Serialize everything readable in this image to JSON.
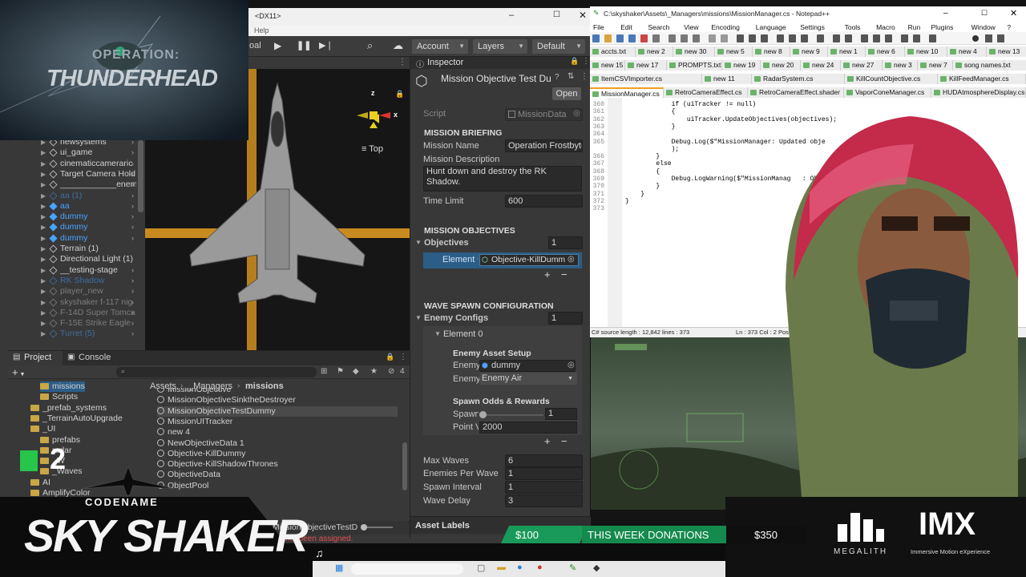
{
  "stream": {
    "logo_top_line": "OPERATION:",
    "logo_bottom_line": "THUNDERHEAD",
    "codename_label": "CODENAME",
    "game_title": "SKY SHAKER",
    "badge_count": "2",
    "donation_left": "$100",
    "donation_title": "THIS WEEK DONATIONS",
    "donation_right": "$350",
    "sponsor_name": "MEGALITH",
    "partner_name": "IMX",
    "partner_tagline": "Immersive Motion eXperience"
  },
  "unity": {
    "title_suffix": "<DX11>",
    "menu_help": "Help",
    "toolbar": {
      "account_label": "Account",
      "layers_label": "Layers",
      "layout_label": "Default",
      "left_tab_fragment": "oal"
    },
    "scene": {
      "gizmo_count": "0",
      "orientation_label": "Top",
      "axis_x": "x",
      "axis_z": "z"
    },
    "hierarchy": [
      {
        "label": "newsystems",
        "style": "normal",
        "arrow": true
      },
      {
        "label": "ui_game",
        "style": "normal",
        "arrow": true
      },
      {
        "label": "cinematiccameraric",
        "style": "normal",
        "arrow": true
      },
      {
        "label": "Target Camera Hold",
        "style": "normal",
        "arrow": true
      },
      {
        "label": "____________enem",
        "style": "normal",
        "arrow": true
      },
      {
        "label": "aa (1)",
        "style": "dimblue",
        "arrow": true
      },
      {
        "label": "aa",
        "style": "blue",
        "arrow": true
      },
      {
        "label": "dummy",
        "style": "blue",
        "arrow": true
      },
      {
        "label": "dummy",
        "style": "blue",
        "arrow": true
      },
      {
        "label": "dummy",
        "style": "blue",
        "arrow": true
      },
      {
        "label": "Terrain (1)",
        "style": "normal",
        "arrow": false
      },
      {
        "label": "Directional Light (1)",
        "style": "normal",
        "arrow": false
      },
      {
        "label": "__testing-stage",
        "style": "normal",
        "arrow": true
      },
      {
        "label": "RK Shadow",
        "style": "dimblue",
        "arrow": true
      },
      {
        "label": "player_new",
        "style": "dim",
        "arrow": true
      },
      {
        "label": "skyshaker f-117 nig",
        "style": "dim",
        "arrow": true
      },
      {
        "label": "F-14D Super Tomca",
        "style": "dim",
        "arrow": true
      },
      {
        "label": "F-15E Strike Eagle",
        "style": "dim",
        "arrow": true
      },
      {
        "label": "Turret (5)",
        "style": "dimblue",
        "arrow": true
      }
    ],
    "inspector": {
      "tab_label": "Inspector",
      "component_title": "Mission Objective Test Du",
      "open_button": "Open",
      "script_label": "Script",
      "script_value": "MissionData",
      "briefing_header": "MISSION BRIEFING",
      "mission_name_label": "Mission Name",
      "mission_name_value": "Operation Frostbyte",
      "mission_description_label": "Mission Description",
      "mission_description_value": "Hunt down and destroy the RK Shadow.",
      "time_limit_label": "Time Limit",
      "time_limit_value": "600",
      "objectives_header": "MISSION OBJECTIVES",
      "objectives_label": "Objectives",
      "objectives_count": "1",
      "element_label": "Element 0",
      "element_value": "Objective-KillDumm",
      "wave_header": "WAVE SPAWN CONFIGURATION",
      "enemy_configs_label": "Enemy Configs",
      "enemy_configs_count": "1",
      "config_element_label": "Element 0",
      "asset_setup_header": "Enemy Asset Setup",
      "enemy_prefab_label": "Enemy",
      "enemy_prefab_value": "dummy",
      "enemy_type_label": "Enemy",
      "enemy_type_value": "Enemy Air",
      "odds_header": "Spawn Odds & Rewards",
      "spawn_label": "Spawn",
      "spawn_value": "1",
      "points_label": "Point V",
      "points_value": "2000",
      "max_waves_label": "Max Waves",
      "max_waves_value": "6",
      "enemies_per_wave_label": "Enemies Per Wave",
      "enemies_per_wave_value": "1",
      "spawn_interval_label": "Spawn Interval",
      "spawn_interval_value": "1",
      "wave_delay_label": "Wave Delay",
      "wave_delay_value": "3",
      "asset_labels_label": "Asset Labels",
      "plus": "+",
      "minus": "−"
    },
    "project": {
      "tab_project": "Project",
      "tab_console": "Console",
      "add_label": "+",
      "breadcrumb": [
        "Assets",
        "_Managers",
        "missions"
      ],
      "asset_count": "4",
      "folders": [
        {
          "label": "missions",
          "indent": 1
        },
        {
          "label": "Scripts",
          "indent": 1
        },
        {
          "label": "_prefab_systems",
          "indent": 0
        },
        {
          "label": "_TerrainAutoUpgrade",
          "indent": 0
        },
        {
          "label": "_UI",
          "indent": 0
        },
        {
          "label": "prefabs",
          "indent": 1
        },
        {
          "label": "radar",
          "indent": 1
        },
        {
          "label": "_W",
          "indent": 1
        },
        {
          "label": "_Waves",
          "indent": 1
        },
        {
          "label": "AI",
          "indent": 0
        },
        {
          "label": "AmplifyColor",
          "indent": 0
        }
      ],
      "files": [
        "MissionObjective",
        "MissionObjectiveSinktheDestroyer",
        "MissionObjectiveTestDummy",
        "MissionUITracker",
        "new 4",
        "NewObjectiveData 1",
        "Objective-KillDummy",
        "Objective-KillShadowThrones",
        "ObjectiveData",
        "ObjectPool"
      ],
      "status_path": "MissionObjectiveTestD",
      "error_fragment": "not been assigned."
    }
  },
  "notepad": {
    "title": "C:\\skyshaker\\Assets\\_Managers\\missions\\MissionManager.cs - Notepad++",
    "menu": [
      "File",
      "Edit",
      "Search",
      "View",
      "Encoding",
      "Language",
      "Settings",
      "Tools",
      "Macro",
      "Run",
      "Plugins",
      "Window",
      "?"
    ],
    "tabs_row1": [
      "accts.txt",
      "new 2",
      "new 30",
      "new 5",
      "new 8",
      "new 9",
      "new 1",
      "new 6",
      "new 10",
      "new 4",
      "new 13"
    ],
    "tabs_row2": [
      "new 15",
      "new 17",
      "PROMPTS.txt",
      "new 19",
      "new 20",
      "new 24",
      "new 27",
      "new 3",
      "new 7",
      "song names.txt"
    ],
    "tabs_row3": [
      "ItemCSVImporter.cs",
      "new 11",
      "RadarSystem.cs",
      "KillCountObjective.cs",
      "KillFeedManager.cs"
    ],
    "tabs_row4": [
      "MissionManager.cs",
      "RetroCameraEffect.cs",
      "RetroCameraEffect.shader",
      "VaporConeManager.cs",
      "HUDAtmosphereDisplay.cs"
    ],
    "code_lines": [
      {
        "num": "360",
        "text": "            if (uiTracker != null)"
      },
      {
        "num": "361",
        "text": "            {"
      },
      {
        "num": "362",
        "text": "                uiTracker.UpdateObjectives(objectives);"
      },
      {
        "num": "363",
        "text": "            }"
      },
      {
        "num": "364",
        "text": ""
      },
      {
        "num": "365",
        "text": "            Debug.Log($\"MissionManager: Updated obje                  t}/{total}\""
      },
      {
        "num": "",
        "text": "            );"
      },
      {
        "num": "366",
        "text": "        }"
      },
      {
        "num": "367",
        "text": "        else"
      },
      {
        "num": "368",
        "text": "        {"
      },
      {
        "num": "369",
        "text": "            Debug.LogWarning($\"MissionManag   : Ob"
      },
      {
        "num": "370",
        "text": "        }"
      },
      {
        "num": "371",
        "text": "    }"
      },
      {
        "num": "372",
        "text": "}"
      },
      {
        "num": "373",
        "text": ""
      }
    ],
    "status_left": "C# source length : 12,842    lines : 373",
    "status_right": "Ln : 373    Col : 2    Pos : 12,843"
  }
}
